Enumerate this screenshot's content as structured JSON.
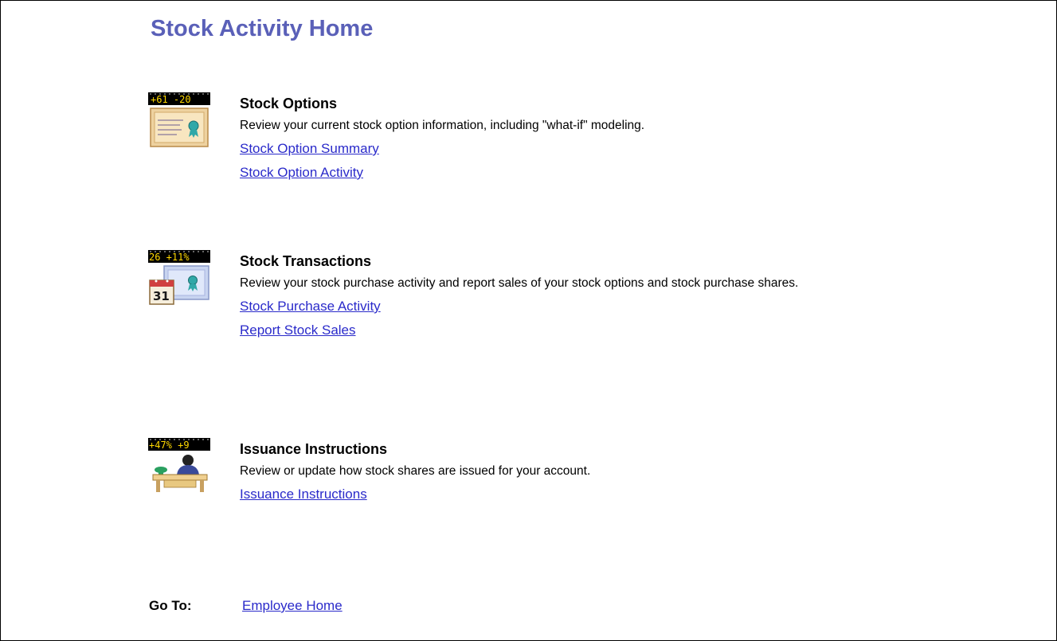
{
  "page": {
    "title": "Stock Activity Home"
  },
  "sections": [
    {
      "ticker": "+61 -20",
      "title": "Stock Options",
      "description": "Review your current stock option information, including \"what-if\" modeling.",
      "links": [
        "Stock Option Summary",
        "Stock Option Activity"
      ]
    },
    {
      "ticker": "26 +11%",
      "calendar_day": "31",
      "title": "Stock Transactions",
      "description": "Review your stock purchase activity and report sales of your stock options and stock purchase shares.",
      "links": [
        "Stock Purchase Activity",
        "Report Stock Sales"
      ]
    },
    {
      "ticker": "+47% +9",
      "title": "Issuance Instructions",
      "description": "Review or update how stock shares are issued for your account.",
      "links": [
        "Issuance Instructions"
      ]
    }
  ],
  "goto": {
    "label": "Go To:",
    "link": "Employee Home"
  },
  "colors": {
    "title": "#5a60b8",
    "link": "#2a2aca",
    "ticker_text": "#ffd800"
  }
}
